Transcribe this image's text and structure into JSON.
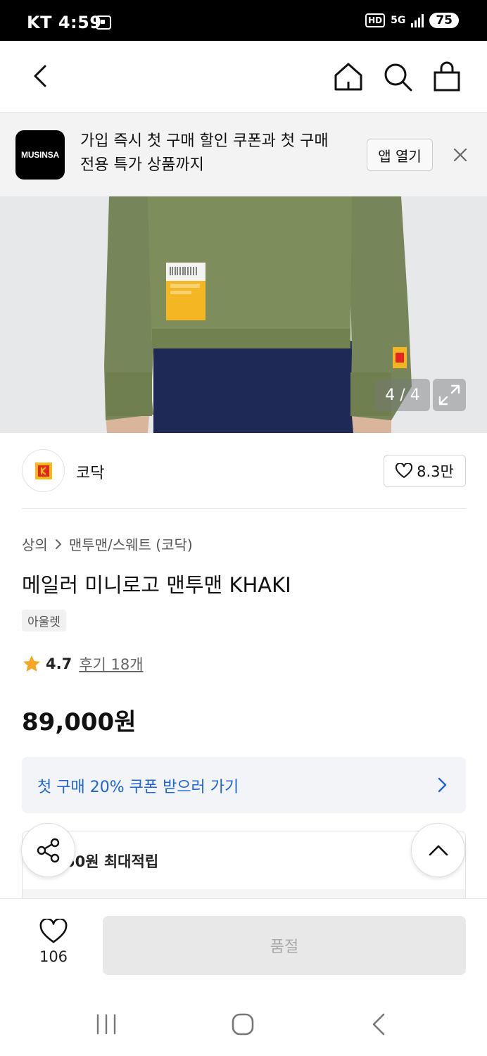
{
  "status_bar": {
    "carrier_time": "KT 4:59",
    "hd": "HD",
    "network": "5G",
    "battery": "75"
  },
  "top_nav": {
    "icons": [
      "back-icon",
      "home-icon",
      "search-icon",
      "shopping-bag-icon"
    ]
  },
  "banner": {
    "logo_text": "MUSINSA",
    "message_line1": "가입 즉시 첫 구매 할인 쿠폰과 첫 구매",
    "message_line2": "전용 특가 상품까지",
    "open_app_label": "앱 열기"
  },
  "gallery": {
    "counter": "4 / 4"
  },
  "brand": {
    "name": "코닥",
    "likes": "8.3만"
  },
  "breadcrumb": {
    "category": "상의",
    "subcategory": "맨투맨/스웨트 (코닥)"
  },
  "product": {
    "title": "메일러 미니로고 맨투맨 KHAKI",
    "tag": "아울렛",
    "rating": "4.7",
    "reviews": "후기 18개",
    "price": "89,000원"
  },
  "coupon": {
    "label": "첫 구매 20% 쿠폰 받으러 가기"
  },
  "points": {
    "label": "50원 최대적립"
  },
  "bottom_bar": {
    "wish_count": "106",
    "buy_label": "품절"
  },
  "colors": {
    "coupon_text": "#1d64d8",
    "star": "#f5a623",
    "sweatshirt": "#7a8a58",
    "kodak_red": "#e3261f",
    "kodak_yellow": "#f6b81a"
  }
}
